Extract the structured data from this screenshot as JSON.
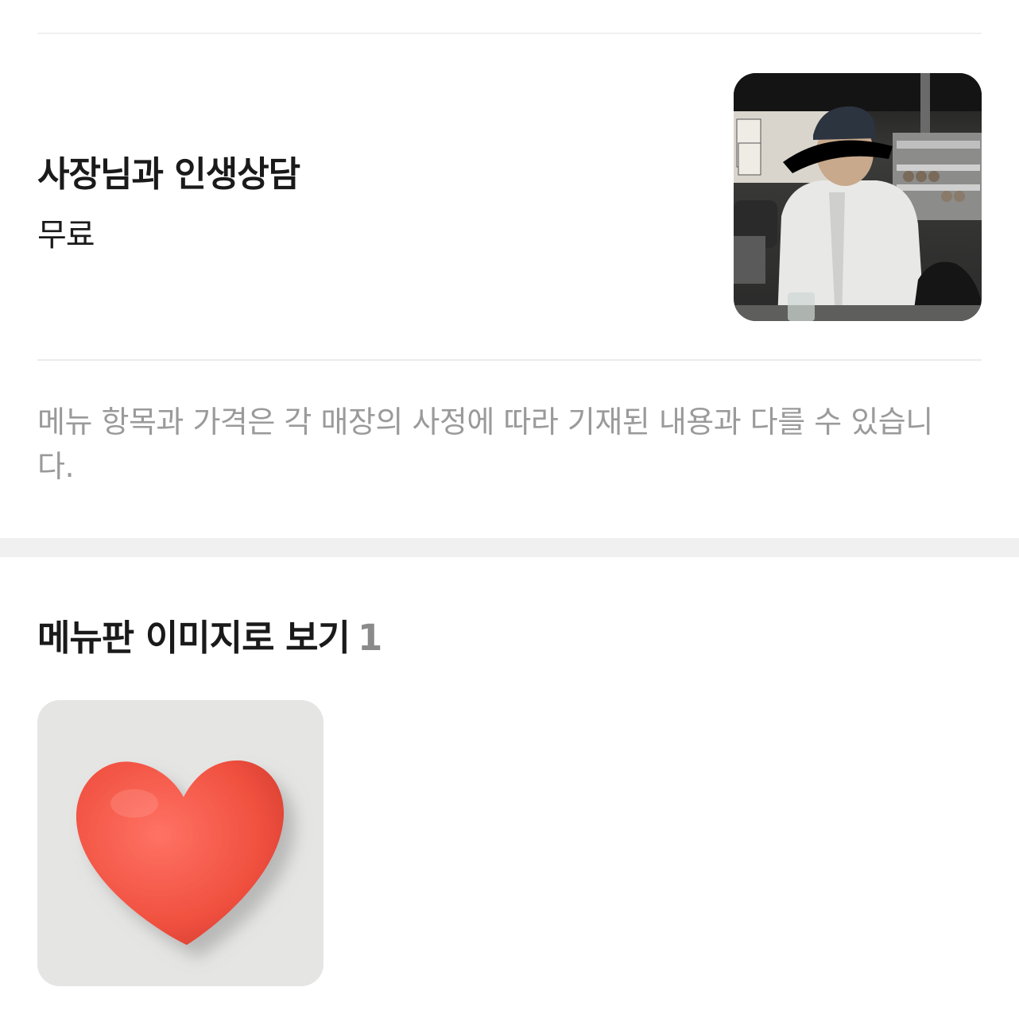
{
  "menu_item": {
    "name": "사장님과 인생상담",
    "price": "무료",
    "photo_icon": "owner-photo"
  },
  "notice": "메뉴 항목과 가격은 각 매장의 사정에 따라 기재된 내용과 다를 수 있습니다.",
  "menu_board": {
    "title": "메뉴판 이미지로 보기",
    "count": "1",
    "thumbnail_icon": "red-heart-image"
  },
  "colors": {
    "divider": "#f0f0f0",
    "muted_text": "#9a9a9a",
    "count_text": "#8a8a8a",
    "heart": "#f25a4a"
  }
}
